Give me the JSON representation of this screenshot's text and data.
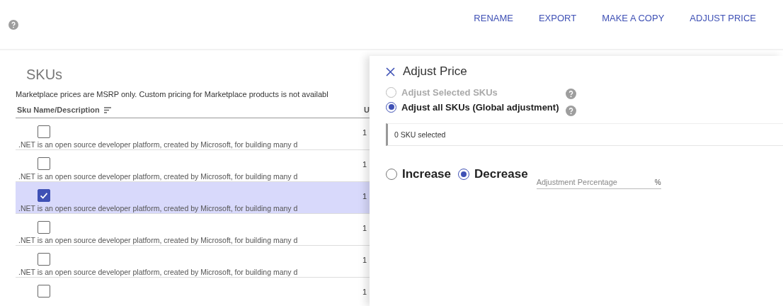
{
  "toolbar": {
    "actions": [
      "RENAME",
      "EXPORT",
      "MAKE A COPY",
      "ADJUST PRICE"
    ]
  },
  "skus": {
    "title": "SKUs",
    "notice": "Marketplace prices are MSRP only. Custom pricing for Marketplace products is not availabl",
    "columns": [
      "Sku Name/Description",
      "U"
    ],
    "rows": [
      {
        "checked": false,
        "description": ".NET is an open source developer platform, created by Microsoft, for building many d",
        "column_2": "1"
      },
      {
        "checked": false,
        "description": ".NET is an open source developer platform, created by Microsoft, for building many d",
        "column_2": "1"
      },
      {
        "checked": true,
        "description": ".NET is an open source developer platform, created by Microsoft, for building many d",
        "column_2": "1"
      },
      {
        "checked": false,
        "description": ".NET is an open source developer platform, created by Microsoft, for building many d",
        "column_2": "1"
      },
      {
        "checked": false,
        "description": ".NET is an open source developer platform, created by Microsoft, for building many d",
        "column_2": "1"
      },
      {
        "checked": false,
        "column_2": "1"
      }
    ]
  },
  "drawer": {
    "title": "Adjust Price",
    "scope_options": [
      {
        "label": "Adjust Selected SKUs",
        "selected": false,
        "disabled": true
      },
      {
        "label": "Adjust all SKUs (Global adjustment)",
        "selected": true,
        "disabled": false
      }
    ],
    "selection_info": "0 SKU selected",
    "direction_options": [
      {
        "label": "Increase",
        "selected": false
      },
      {
        "label": "Decrease",
        "selected": true
      }
    ],
    "percentage_field": {
      "placeholder": "Adjustment Percentage",
      "suffix": "%"
    }
  }
}
